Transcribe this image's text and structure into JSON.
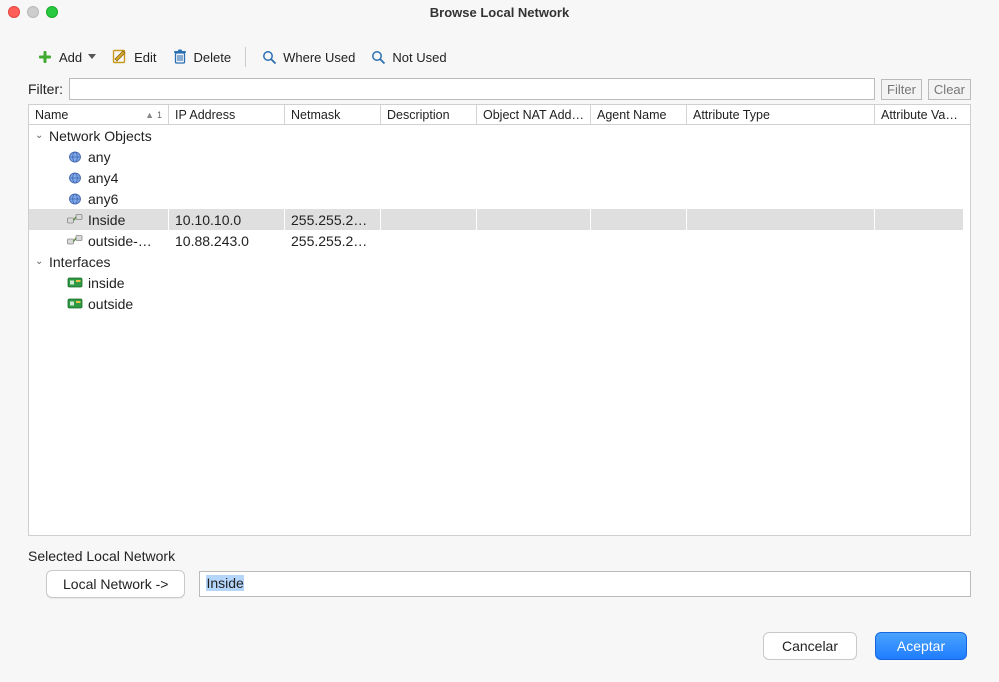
{
  "window": {
    "title": "Browse Local Network"
  },
  "toolbar": {
    "add": "Add",
    "edit": "Edit",
    "delete": "Delete",
    "where_used": "Where Used",
    "not_used": "Not Used"
  },
  "filter": {
    "label": "Filter:",
    "value": "",
    "filter_btn": "Filter",
    "clear_btn": "Clear"
  },
  "columns": {
    "name": "Name",
    "ip": "IP Address",
    "mask": "Netmask",
    "desc": "Description",
    "nat": "Object NAT Add…",
    "agent": "Agent Name",
    "attr_type": "Attribute Type",
    "attr_val": "Attribute Va…",
    "sort_index": "1"
  },
  "groups": [
    {
      "label": "Network Objects",
      "rows": [
        {
          "icon": "globe",
          "name": "any",
          "ip": "",
          "mask": ""
        },
        {
          "icon": "globe",
          "name": "any4",
          "ip": "",
          "mask": ""
        },
        {
          "icon": "globe",
          "name": "any6",
          "ip": "",
          "mask": ""
        },
        {
          "icon": "host",
          "name": "Inside",
          "ip": "10.10.10.0",
          "mask": "255.255.2…",
          "selected": true
        },
        {
          "icon": "host",
          "name": "outside-…",
          "ip": "10.88.243.0",
          "mask": "255.255.2…"
        }
      ]
    },
    {
      "label": "Interfaces",
      "rows": [
        {
          "icon": "nic",
          "name": "inside",
          "ip": "",
          "mask": ""
        },
        {
          "icon": "nic",
          "name": "outside",
          "ip": "",
          "mask": ""
        }
      ]
    }
  ],
  "selected_panel": {
    "heading": "Selected Local Network",
    "button": "Local Network ->",
    "value": "Inside"
  },
  "footer": {
    "cancel": "Cancelar",
    "accept": "Aceptar"
  },
  "col_widths": {
    "name": 140,
    "ip": 116,
    "mask": 96,
    "desc": 96,
    "nat": 114,
    "agent": 96,
    "attr_type": 188,
    "attr_val": 88
  }
}
